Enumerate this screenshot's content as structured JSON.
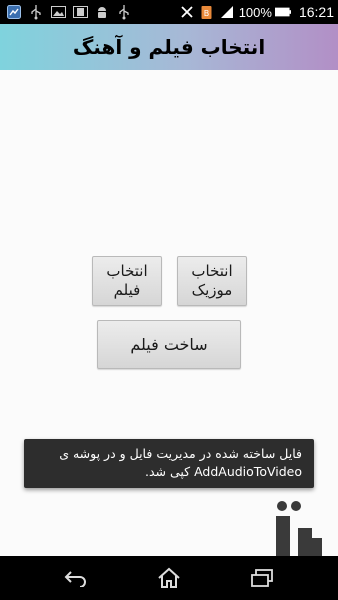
{
  "status_bar": {
    "battery_percent": "100%",
    "time": "16:21",
    "left_icons": [
      "app-notification-icon",
      "usb-icon",
      "image-icon",
      "film-icon",
      "android-icon",
      "usb-icon"
    ],
    "right_icons": [
      "mute-icon",
      "battery-saver-icon",
      "signal-icon",
      "battery-icon"
    ]
  },
  "title_bar": {
    "title": "انتخاب فیلم و آهنگ",
    "gradient": [
      "#7fd3dd",
      "#b28fc6"
    ]
  },
  "buttons": {
    "select_music": "انتخاب\nموزیک",
    "select_film": "انتخاب\nفیلم",
    "make_film": "ساخت فیلم"
  },
  "toast": {
    "line1": "فایل ساخته شده در مدیریت فایل و در پوشه ی",
    "line2": "AddAudioToVideo کپی شد."
  },
  "watermark": {
    "icon": "bazaar-logo-icon",
    "color": "#3a3a3a"
  },
  "nav_bar": {
    "icons": [
      "back-icon",
      "home-icon",
      "recent-apps-icon"
    ]
  }
}
